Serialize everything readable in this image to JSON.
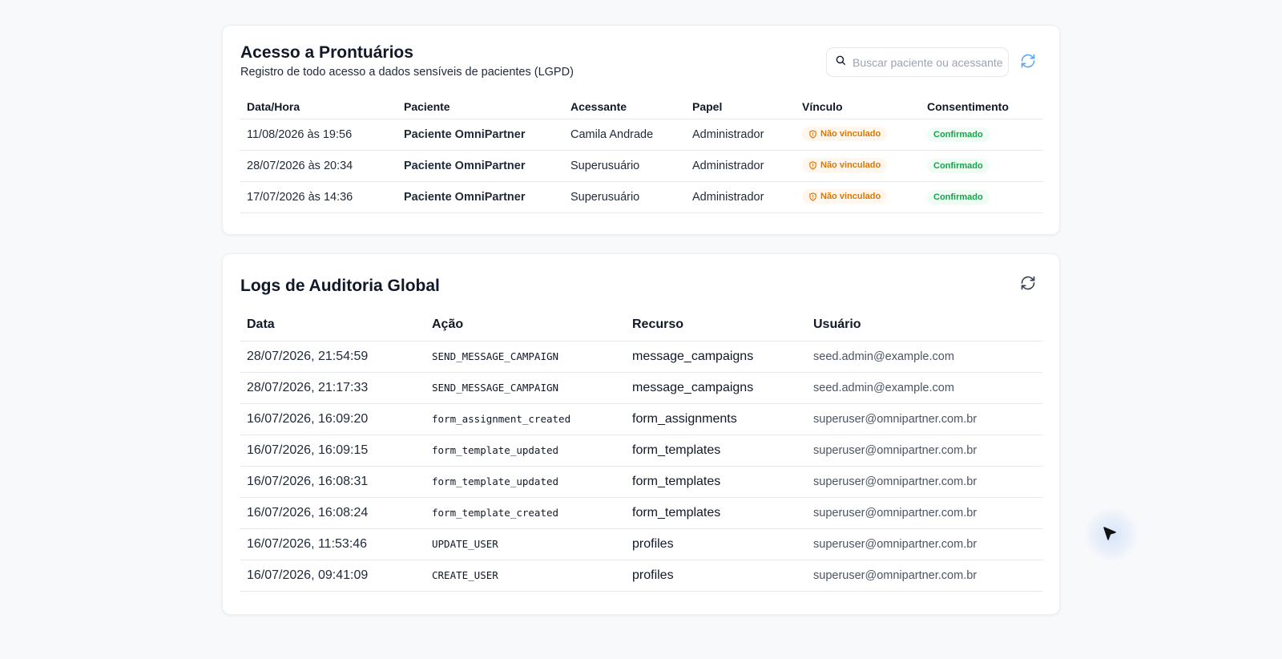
{
  "access_section": {
    "title": "Acesso a Prontuários",
    "subtitle": "Registro de todo acesso a dados sensíveis de pacientes (LGPD)",
    "search_placeholder": "Buscar paciente ou acessante",
    "columns": [
      "Data/Hora",
      "Paciente",
      "Acessante",
      "Papel",
      "Vínculo",
      "Consentimento"
    ],
    "rows": [
      {
        "datetime": "11/08/2026 às 19:56",
        "patient": "Paciente OmniPartner",
        "accessor": "Camila Andrade",
        "role": "Administrador",
        "link": "Não vinculado",
        "consent": "Confirmado"
      },
      {
        "datetime": "28/07/2026 às 20:34",
        "patient": "Paciente OmniPartner",
        "accessor": "Superusuário",
        "role": "Administrador",
        "link": "Não vinculado",
        "consent": "Confirmado"
      },
      {
        "datetime": "17/07/2026 às 14:36",
        "patient": "Paciente OmniPartner",
        "accessor": "Superusuário",
        "role": "Administrador",
        "link": "Não vinculado",
        "consent": "Confirmado"
      }
    ]
  },
  "audit_section": {
    "title": "Logs de Auditoria Global",
    "columns": [
      "Data",
      "Ação",
      "Recurso",
      "Usuário"
    ],
    "rows": [
      {
        "date": "28/07/2026, 21:54:59",
        "action": "SEND_MESSAGE_CAMPAIGN",
        "resource": "message_campaigns",
        "user": "seed.admin@example.com"
      },
      {
        "date": "28/07/2026, 21:17:33",
        "action": "SEND_MESSAGE_CAMPAIGN",
        "resource": "message_campaigns",
        "user": "seed.admin@example.com"
      },
      {
        "date": "16/07/2026, 16:09:20",
        "action": "form_assignment_created",
        "resource": "form_assignments",
        "user": "superuser@omnipartner.com.br"
      },
      {
        "date": "16/07/2026, 16:09:15",
        "action": "form_template_updated",
        "resource": "form_templates",
        "user": "superuser@omnipartner.com.br"
      },
      {
        "date": "16/07/2026, 16:08:31",
        "action": "form_template_updated",
        "resource": "form_templates",
        "user": "superuser@omnipartner.com.br"
      },
      {
        "date": "16/07/2026, 16:08:24",
        "action": "form_template_created",
        "resource": "form_templates",
        "user": "superuser@omnipartner.com.br"
      },
      {
        "date": "16/07/2026, 11:53:46",
        "action": "UPDATE_USER",
        "resource": "profiles",
        "user": "superuser@omnipartner.com.br"
      },
      {
        "date": "16/07/2026, 09:41:09",
        "action": "CREATE_USER",
        "resource": "profiles",
        "user": "superuser@omnipartner.com.br"
      }
    ]
  },
  "icons": {
    "search": "search-icon",
    "refresh": "refresh-icon",
    "warning": "shield-alert-icon",
    "cursor": "mouse-cursor-icon"
  },
  "colors": {
    "refresh_active": "#60a5fa",
    "refresh_idle": "#374151",
    "warning_badge_text": "#d97706",
    "warning_badge_bg": "#fff7ed",
    "success_badge_text": "#16a34a",
    "success_badge_bg": "#f0fdf4"
  }
}
